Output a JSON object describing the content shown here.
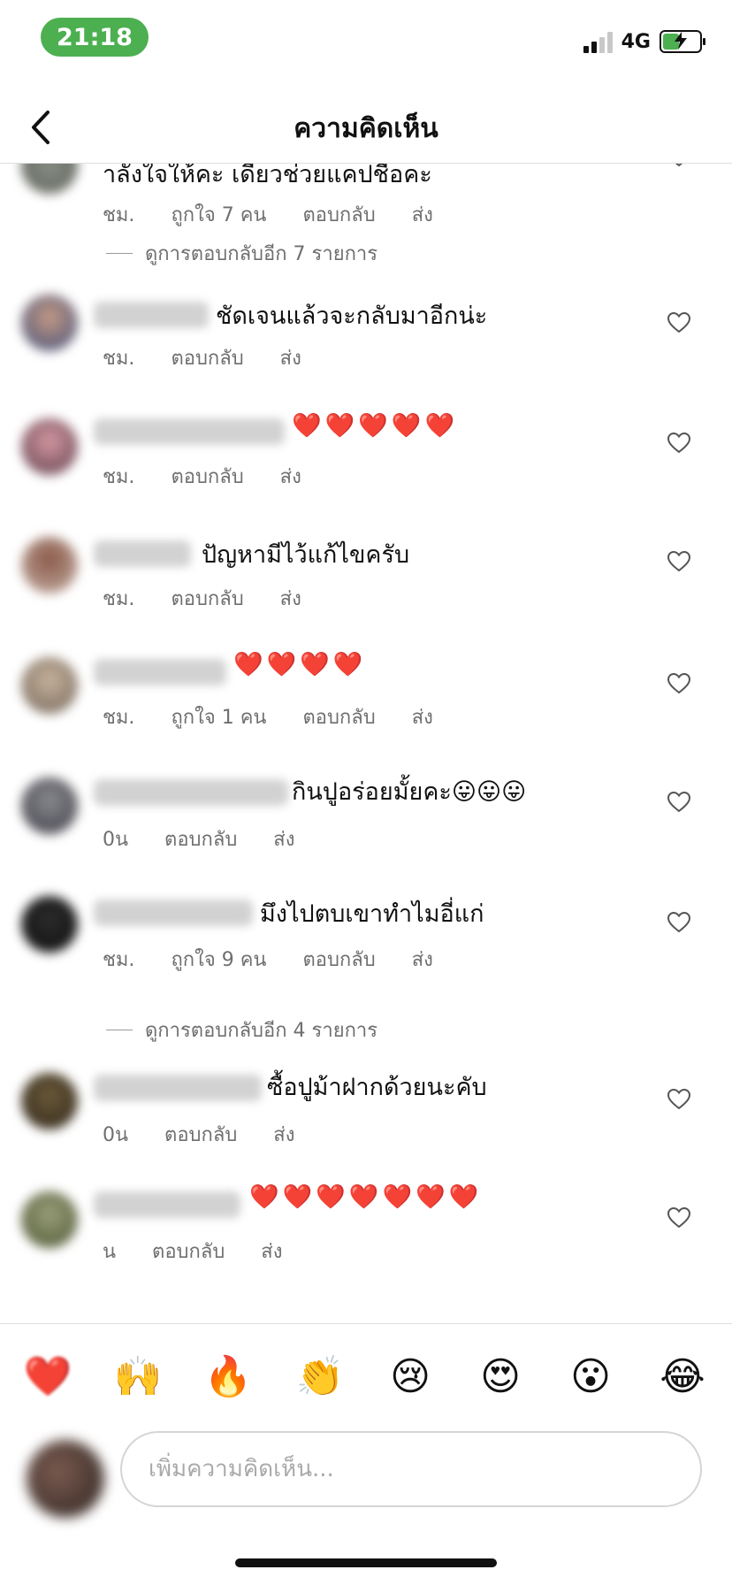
{
  "status_bar": {
    "time": "21:18",
    "network": "4G",
    "time_pill_color": "#4caf50"
  },
  "header": {
    "title": "ความคิดเห็น",
    "back_icon": "chevron-left-icon"
  },
  "comments": [
    {
      "text": "าลังใจให้คะ เดี๋ยวช่วยแคปชื่อคะ",
      "time": "ชม.",
      "likes": "ถูกใจ 7 คน",
      "reply": "ตอบกลับ",
      "send": "ส่ง"
    },
    {
      "text": "ชัดเจนแล้วจะกลับมาอีกน่ะ",
      "time": "ชม.",
      "reply": "ตอบกลับ",
      "send": "ส่ง"
    },
    {
      "text": "❤️❤️❤️❤️❤️",
      "time": "ชม.",
      "reply": "ตอบกลับ",
      "send": "ส่ง"
    },
    {
      "text": "ปัญหามีไว้แก้ไขครับ",
      "time": "ชม.",
      "reply": "ตอบกลับ",
      "send": "ส่ง"
    },
    {
      "text": "❤️❤️❤️❤️",
      "time": "ชม.",
      "likes": "ถูกใจ 1 คน",
      "reply": "ตอบกลับ",
      "send": "ส่ง"
    },
    {
      "text": "กินปูอร่อยมั้ยคะ😛😛😛",
      "time": "0น",
      "reply": "ตอบกลับ",
      "send": "ส่ง"
    },
    {
      "text": "มึงไปตบเขาทำไมอี่แก่",
      "time": "ชม.",
      "likes": "ถูกใจ 9 คน",
      "reply": "ตอบกลับ",
      "send": "ส่ง"
    },
    {
      "text": "ซื้อปูม้าฝากด้วยนะคับ",
      "time": "0น",
      "reply": "ตอบกลับ",
      "send": "ส่ง"
    },
    {
      "text": "❤️❤️❤️❤️❤️❤️❤️",
      "time": "น",
      "reply": "ตอบกลับ",
      "send": "ส่ง"
    }
  ],
  "view_replies": [
    {
      "label": "ดูการตอบกลับอีก 7 รายการ"
    },
    {
      "label": "ดูการตอบกลับอีก 4 รายการ"
    }
  ],
  "reactions": [
    "❤️",
    "🙌",
    "🔥",
    "👏",
    "😢",
    "😍",
    "😮",
    "😂"
  ],
  "composer": {
    "placeholder": "เพิ่มความคิดเห็น..."
  }
}
